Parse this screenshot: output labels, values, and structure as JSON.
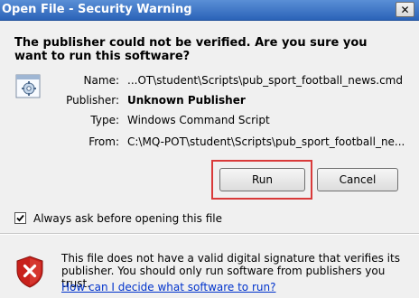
{
  "window": {
    "title": "Open File - Security Warning",
    "close_symbol": "✕"
  },
  "warning": {
    "headline": "The publisher could not be verified.  Are you sure you want to run this software?"
  },
  "details": [
    {
      "label": "Name:",
      "value": "...OT\\student\\Scripts\\pub_sport_football_news.cmd",
      "bold": false
    },
    {
      "label": "Publisher:",
      "value": "Unknown Publisher",
      "bold": true
    },
    {
      "label": "Type:",
      "value": "Windows Command Script",
      "bold": false
    },
    {
      "label": "From:",
      "value": "C:\\MQ-POT\\student\\Scripts\\pub_sport_football_ne...",
      "bold": false
    }
  ],
  "buttons": {
    "run_label": "Run",
    "cancel_label": "Cancel"
  },
  "checkbox": {
    "label": "Always ask before opening this file",
    "checked": true
  },
  "footer": {
    "message": "This file does not have a valid digital signature that verifies its publisher.  You should only run software from publishers you trust.",
    "link_text": "How can I decide what software to run?"
  },
  "colors": {
    "title_bar": "#2b63b8",
    "highlight": "#d93a3a",
    "link": "#0033cc",
    "shield": "#c8201b"
  },
  "icons": [
    "close-icon",
    "script-file-icon",
    "checkmark-icon",
    "security-shield-icon"
  ]
}
